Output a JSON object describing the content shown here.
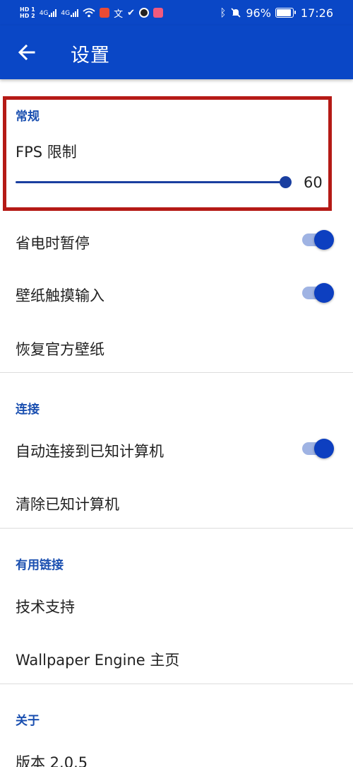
{
  "status_bar": {
    "hd1": "HD 1",
    "hd2": "HD 2",
    "sig1": "4G",
    "sig2": "4G",
    "battery": "96%",
    "battery_level": 0.96,
    "time": "17:26"
  },
  "app_bar": {
    "title": "设置"
  },
  "sections": {
    "general": {
      "header": "常规",
      "fps_label": "FPS 限制",
      "fps_value": "60",
      "fps_slider_fraction": 1.0,
      "pause_on_saving": {
        "label": "省电时暂停",
        "on": true
      },
      "wallpaper_touch": {
        "label": "壁纸触摸输入",
        "on": true
      },
      "restore_wallpaper": {
        "label": "恢复官方壁纸"
      }
    },
    "connection": {
      "header": "连接",
      "auto_connect": {
        "label": "自动连接到已知计算机",
        "on": true
      },
      "clear_known": {
        "label": "清除已知计算机"
      }
    },
    "links": {
      "header": "有用链接",
      "support": {
        "label": "技术支持"
      },
      "homepage": {
        "label": "Wallpaper Engine 主页"
      }
    },
    "about": {
      "header": "关于",
      "version": {
        "label": "版本 2.0.5"
      }
    }
  },
  "colors": {
    "primary": "#0a47c6",
    "accent": "#0d3fc0",
    "highlight_border": "#b51a16"
  }
}
